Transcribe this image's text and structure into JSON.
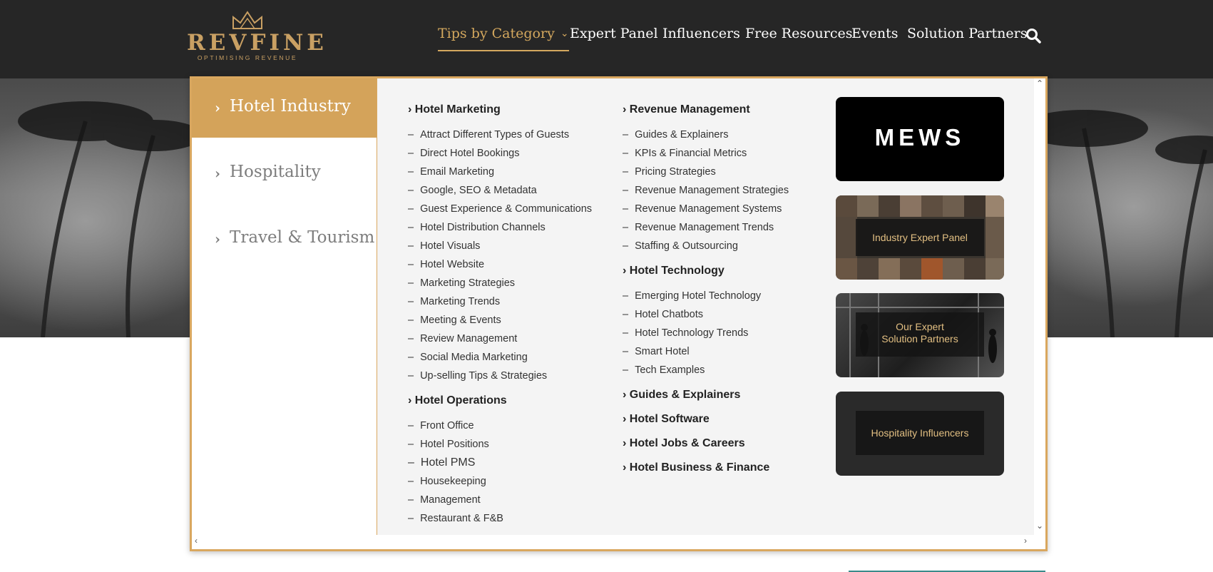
{
  "brand": {
    "name": "REVFINE",
    "tagline": "OPTIMISING REVENUE"
  },
  "nav": [
    {
      "label": "Tips by Category",
      "active": true
    },
    {
      "label": "Expert Panel"
    },
    {
      "label": "Influencers"
    },
    {
      "label": "Free Resources"
    },
    {
      "label": "Events"
    },
    {
      "label": "Solution Partners"
    }
  ],
  "categories": [
    {
      "label": "Hotel Industry",
      "active": true
    },
    {
      "label": "Hospitality"
    },
    {
      "label": "Travel & Tourism"
    }
  ],
  "columns": {
    "hotel_marketing": {
      "title": "› Hotel Marketing",
      "items": [
        "Attract Different Types of  Guests",
        "Direct Hotel Bookings",
        "Email Marketing",
        "Google, SEO & Metadata",
        "Guest Experience & Communications",
        "Hotel Distribution Channels",
        "Hotel Visuals",
        "Hotel Website",
        "Marketing Strategies",
        "Marketing Trends",
        "Meeting & Events",
        "Review Management",
        "Social Media Marketing",
        "Up-selling Tips & Strategies"
      ]
    },
    "hotel_operations": {
      "title": "› Hotel Operations",
      "items": [
        "Front Office",
        "Hotel Positions",
        "Hotel PMS",
        "Housekeeping",
        "Management",
        "Restaurant & F&B"
      ]
    },
    "revenue_management": {
      "title": "› Revenue Management",
      "items": [
        "Guides & Explainers",
        "KPIs & Financial Metrics",
        "Pricing Strategies",
        "Revenue Management Strategies",
        "Revenue Management Systems",
        "Revenue Management Trends",
        "Staffing & Outsourcing"
      ]
    },
    "hotel_technology": {
      "title": "› Hotel Technology",
      "items": [
        "Emerging Hotel Technology",
        "Hotel Chatbots",
        "Hotel Technology Trends",
        "Smart Hotel",
        "Tech Examples"
      ]
    },
    "other_headings": [
      "› Guides & Explainers",
      "› Hotel Software",
      "› Hotel Jobs & Careers",
      "› Hotel Business & Finance"
    ]
  },
  "promos": {
    "mews": "MEWS",
    "expert_panel": "Industry Expert Panel",
    "partners_line1": "Our Expert",
    "partners_line2": "Solution Partners",
    "influencers": "Hospitality Influencers"
  },
  "icons": {
    "search": "search-icon",
    "chevron": "chevron-down-icon",
    "crown": "crown-icon"
  },
  "colors": {
    "accent": "#d4a35a",
    "header_bg": "#262626",
    "panel_bg": "#f4f4f4"
  }
}
